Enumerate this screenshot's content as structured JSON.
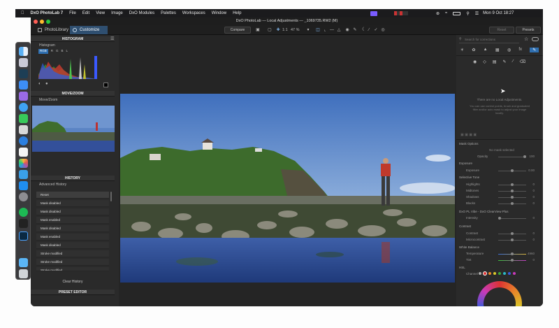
{
  "menubar": {
    "app_name": "DxO PhotoLab 7",
    "items": [
      "File",
      "Edit",
      "View",
      "Image",
      "DxO Modules",
      "Palettes",
      "Workspaces",
      "Window",
      "Help"
    ],
    "datetime": "Mon 9 Oct  18:27"
  },
  "window": {
    "title": "DxO PhotoLab — Local Adjustments — _1069735.RW2 (M)"
  },
  "tabs": {
    "library": "PhotoLibrary",
    "customize": "Customize"
  },
  "toolbar": {
    "compare": "Compare",
    "ratio": "1:1",
    "zoom": "47 %",
    "reset": "Reset",
    "presets": "Presets"
  },
  "left": {
    "histogram_header": "HISTOGRAM",
    "histogram_sub": "Histogram",
    "channels": [
      "RGB",
      "R",
      "G",
      "B",
      "L"
    ],
    "movezoom_header": "MOVE/ZOOM",
    "movezoom_sub": "Move/Zoom",
    "history_header": "HISTORY",
    "history_sub": "Advanced History",
    "history_items": [
      "Reset",
      "Mask disabled",
      "Mask disabled",
      "Mask enabled",
      "Mask disabled",
      "Mask enabled",
      "Mask disabled",
      "Stroke modified",
      "Stroke modified",
      "Stroke modified"
    ],
    "clear_history": "Clear History",
    "preset_header": "PRESET EDITOR"
  },
  "right": {
    "search_placeholder": "Search for corrections",
    "empty_title": "There are no Local Adjustments.",
    "empty_body": "You can use control points, brush and graduated filter and/or auto mask to adjust your image locally.",
    "mask_options": "Mask Options",
    "no_mask": "No mask selected",
    "opacity_label": "Opacity",
    "opacity_val": "100",
    "exposure": "Exposure",
    "exposure_label": "Exposure",
    "exposure_val": "0.00",
    "selective_tone": "Selective Tone",
    "tones": [
      {
        "label": "Highlights",
        "val": "0"
      },
      {
        "label": "Midtones",
        "val": "0"
      },
      {
        "label": "Shadows",
        "val": "0"
      },
      {
        "label": "Blacks",
        "val": "0"
      }
    ],
    "clearview": "DxO PL Vibe - DxO ClearView Plus",
    "intensity_label": "Intensity",
    "intensity_val": "0",
    "contrast": "Contrast",
    "contrast_rows": [
      {
        "label": "Contrast",
        "val": "0"
      },
      {
        "label": "Microcontrast",
        "val": "0"
      }
    ],
    "white_balance": "White Balance",
    "wb_rows": [
      {
        "label": "Temperature",
        "val": "4960"
      },
      {
        "label": "Tint",
        "val": "0"
      }
    ],
    "hsl": "HSL",
    "channel_label": "Channel"
  },
  "colors": {
    "accent": "#2f6fb0",
    "panel": "#2a2a2a",
    "active_tab": "#2f4f70"
  }
}
